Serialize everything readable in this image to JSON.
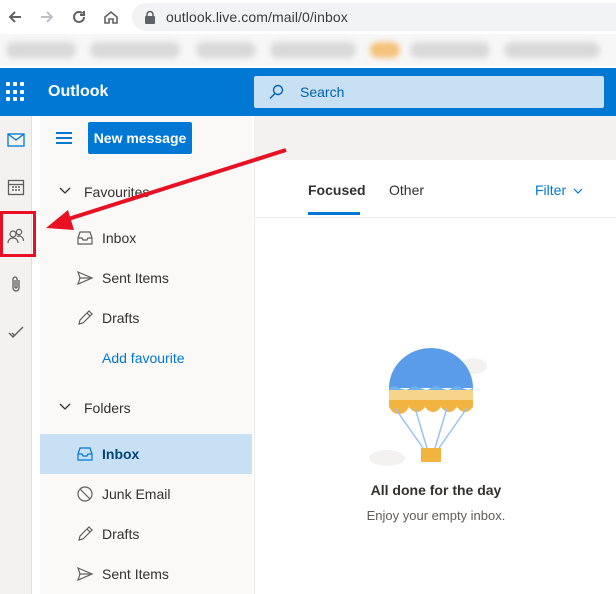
{
  "browser": {
    "url": "outlook.live.com/mail/0/inbox"
  },
  "header": {
    "app_title": "Outlook",
    "search_placeholder": "Search",
    "color": "#0078d4"
  },
  "rail": {
    "items": [
      {
        "icon": "mail-icon"
      },
      {
        "icon": "calendar-icon"
      },
      {
        "icon": "people-icon",
        "highlighted": true
      },
      {
        "icon": "attachment-icon"
      },
      {
        "icon": "todo-icon"
      }
    ]
  },
  "folder_pane": {
    "new_message_label": "New message",
    "favourites": {
      "heading": "Favourites",
      "items": [
        {
          "label": "Inbox",
          "icon": "inbox-icon"
        },
        {
          "label": "Sent Items",
          "icon": "sent-icon"
        },
        {
          "label": "Drafts",
          "icon": "drafts-icon"
        }
      ],
      "add_label": "Add favourite"
    },
    "folders": {
      "heading": "Folders",
      "items": [
        {
          "label": "Inbox",
          "icon": "inbox-icon",
          "selected": true
        },
        {
          "label": "Junk Email",
          "icon": "junk-icon"
        },
        {
          "label": "Drafts",
          "icon": "drafts-icon"
        },
        {
          "label": "Sent Items",
          "icon": "sent-icon"
        }
      ]
    }
  },
  "message_list": {
    "tabs": [
      {
        "label": "Focused",
        "active": true
      },
      {
        "label": "Other",
        "active": false
      }
    ],
    "filter_label": "Filter",
    "empty_title": "All done for the day",
    "empty_subtitle": "Enjoy your empty inbox."
  },
  "annotation": {
    "color": "#e81123"
  }
}
